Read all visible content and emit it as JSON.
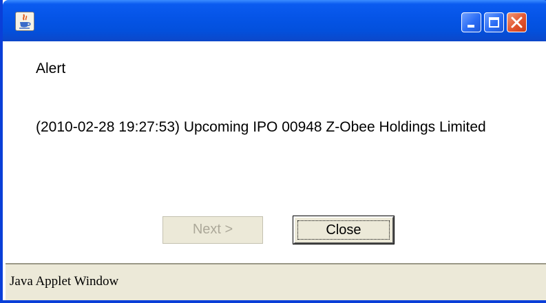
{
  "window": {
    "status_text": "Java Applet Window"
  },
  "titlebar": {
    "icon": "java-icon",
    "minimize_icon": "minimize-icon",
    "maximize_icon": "maximize-icon",
    "close_icon": "close-icon",
    "accent_color": "#0554e6",
    "close_color": "#e2552f"
  },
  "alert": {
    "heading": "Alert",
    "message": "(2010-02-28 19:27:53) Upcoming IPO 00948 Z-Obee Holdings Limited"
  },
  "buttons": {
    "next_label": "Next >",
    "next_enabled": false,
    "close_label": "Close",
    "close_focused": true
  }
}
